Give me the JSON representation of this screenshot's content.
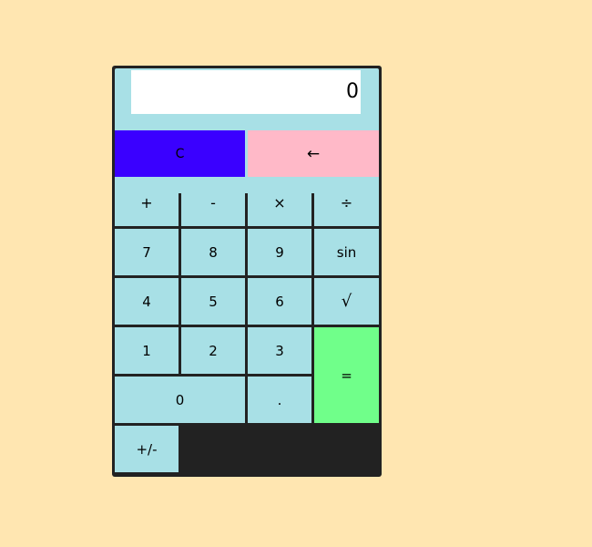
{
  "display": {
    "value": "0"
  },
  "buttons": {
    "clear": "C",
    "backspace": "←",
    "add": "+",
    "subtract": "-",
    "multiply": "×",
    "divide": "÷",
    "seven": "7",
    "eight": "8",
    "nine": "9",
    "sin": "sin",
    "four": "4",
    "five": "5",
    "six": "6",
    "sqrt": "√",
    "one": "1",
    "two": "2",
    "three": "3",
    "equals": "=",
    "zero": "0",
    "decimal": ".",
    "negate": "+/-"
  },
  "colors": {
    "page_background": "#ffe6b1",
    "frame": "#222222",
    "button": "#a8e0e6",
    "clear_button": "#3a00ff",
    "backspace_button": "#ffb9c8",
    "equals_button": "#70ff8a",
    "display_background": "#ffffff"
  }
}
